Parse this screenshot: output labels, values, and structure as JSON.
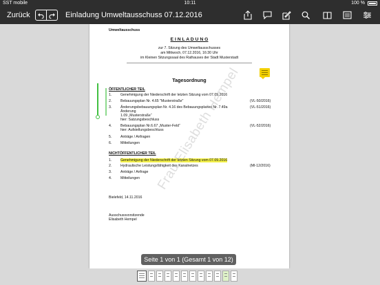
{
  "status_bar": {
    "carrier": "SST mobile",
    "time": "10:11",
    "battery": "100 %"
  },
  "toolbar": {
    "back_label": "Zurück",
    "title": "Einladung Umweltausschuss 07.12.2016",
    "icons": [
      "undo-icon",
      "redo-icon",
      "share-icon",
      "comment-icon",
      "edit-icon",
      "search-icon",
      "book-icon",
      "thumbnails-icon",
      "settings-icon"
    ]
  },
  "document": {
    "header_left": "Umweltausschuss",
    "heading": "E I N L A D U N G",
    "intro_lines": [
      "zur 7. Sitzung des Umweltausschusses",
      "am Mittwoch, 07.12.2016, 16:30 Uhr",
      "im Kleinen Sitzungssaal des Rathauses der Stadt Musterstadt"
    ],
    "agenda_title": "Tagesordnung",
    "public_section": "ÖFFENTLICHER TEIL",
    "public_items": [
      {
        "num": "1.",
        "text": "Genehmigung der Niederschrift der letzten Sitzung vom 07.09.2016",
        "ref": ""
      },
      {
        "num": "2.",
        "text": "Bebauungsplan Nr. 4.65 \"Musterstraße\"",
        "ref": "(VL-50/2016)"
      },
      {
        "num": "3.",
        "text": "Änderungsbebauungsplan Nr. 4.16 des Bebauungsplanes Nr. 7.49a",
        "ref": "(VL-51/2016)"
      },
      {
        "num": "",
        "text": "Änderung",
        "ref": ""
      },
      {
        "num": "",
        "text": "1.09 „Musterstraße“",
        "ref": ""
      },
      {
        "num": "",
        "text": "hier: Satzungsbeschluss",
        "ref": ""
      },
      {
        "num": "4.",
        "text": "Bebauungsplan Nr.6.67 „Muster-Feld“",
        "ref": "(VL-52/2016)"
      },
      {
        "num": "",
        "text": "hier: Aufstellungsbeschluss",
        "ref": ""
      },
      {
        "num": "5.",
        "text": "Anträge / Anfragen",
        "ref": ""
      },
      {
        "num": "6.",
        "text": "Mitteilungen",
        "ref": ""
      }
    ],
    "nonpublic_section": "NICHTÖFFENTLICHER TEIL",
    "nonpublic_items": [
      {
        "num": "1.",
        "text": "Genehmigung der Niederschrift der letzten Sitzung vom 07.09.2016",
        "ref": ""
      },
      {
        "num": "2.",
        "text": "Hydraulische Leistungsfähigkeit des Kanalnetzes",
        "ref": "(MI-12/2016)"
      },
      {
        "num": "3.",
        "text": "Anträge / Anfrage",
        "ref": ""
      },
      {
        "num": "4.",
        "text": "Mitteilungen",
        "ref": ""
      }
    ],
    "date_line": "Bielefeld, 14.11.2016",
    "signature_title": "Ausschussvorsitzende",
    "signature_name": "Elisabeth Hempel",
    "watermark": "Frau Elisabeth Hempel"
  },
  "page_indicator": "Seite 1 von 1 (Gesamt 1 von 12)",
  "thumbnail_count": 12,
  "selected_thumbnail": 1
}
